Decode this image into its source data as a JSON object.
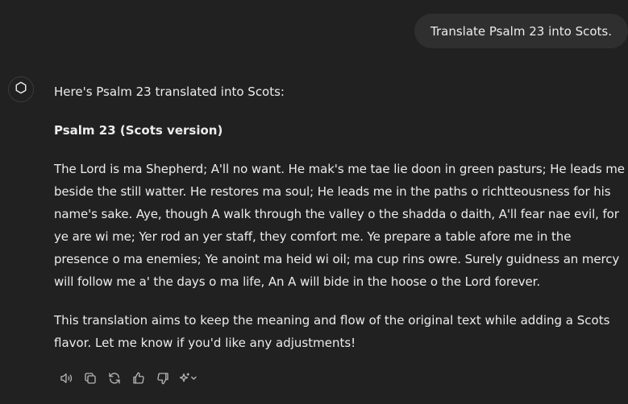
{
  "user_message": "Translate Psalm 23 into Scots.",
  "assistant": {
    "intro": "Here's Psalm 23 translated into Scots:",
    "heading": "Psalm 23 (Scots version)",
    "psalm": "The Lord is ma Shepherd; A'll no want. He mak's me tae lie doon in green pasturs; He leads me beside the still watter. He restores ma soul; He leads me in the paths o richtteousness for his name's sake. Aye, though A walk through the valley o the shadda o daith, A'll fear nae evil, for ye are wi me; Yer rod an yer staff, they comfort me. Ye prepare a table afore me in the presence o ma enemies; Ye anoint ma heid wi oil; ma cup rins owre. Surely guidness an mercy will follow me a' the days o ma life, An A will bide in the hoose o the Lord forever.",
    "closing": "This translation aims to keep the meaning and flow of the original text while adding a Scots flavor. Let me know if you'd like any adjustments!"
  },
  "actions": [
    {
      "icon": "read-aloud-icon"
    },
    {
      "icon": "copy-icon"
    },
    {
      "icon": "regenerate-icon"
    },
    {
      "icon": "thumbs-up-icon"
    },
    {
      "icon": "thumbs-down-icon"
    },
    {
      "icon": "sparkle-model-icon"
    }
  ],
  "colors": {
    "background": "#212121",
    "user_bubble": "#2f2f2f",
    "text": "#ececec",
    "icon": "#b4b4b4"
  }
}
